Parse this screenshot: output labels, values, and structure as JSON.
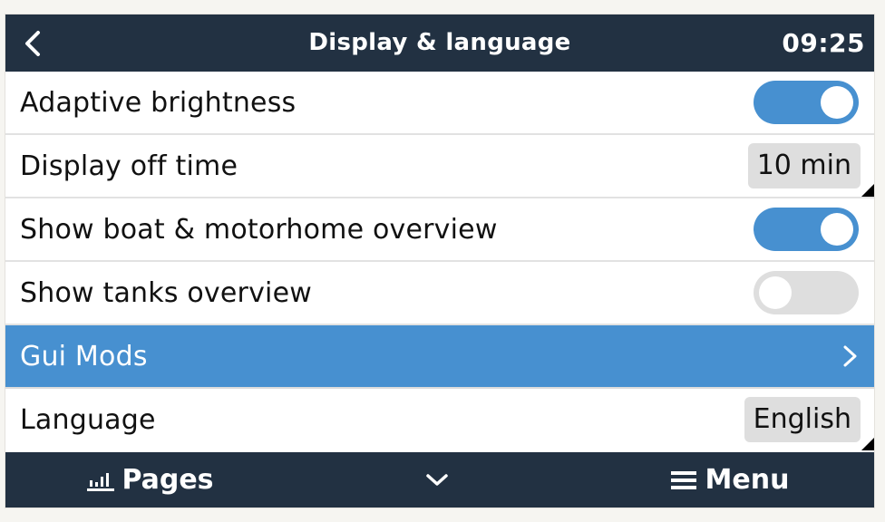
{
  "header": {
    "back_icon": "chevron-left-icon",
    "title": "Display & language",
    "time": "09:25"
  },
  "colors": {
    "header_bg": "#223142",
    "accent": "#4790d0",
    "toggle_off": "#dedede",
    "value_box_bg": "#dedede",
    "page_bg": "#f6f5f1"
  },
  "settings": [
    {
      "label": "Adaptive brightness",
      "type": "toggle",
      "on": true
    },
    {
      "label": "Display off time",
      "type": "value",
      "value": "10 min"
    },
    {
      "label": "Show boat & motorhome overview",
      "type": "toggle",
      "on": true
    },
    {
      "label": "Show tanks overview",
      "type": "toggle",
      "on": false
    },
    {
      "label": "Gui Mods",
      "type": "submenu",
      "selected": true,
      "icon": "chevron-right-icon"
    },
    {
      "label": "Language",
      "type": "value",
      "value": "English"
    }
  ],
  "footer": {
    "pages_label": "Pages",
    "pages_icon": "bar-chart-icon",
    "scroll_icon": "chevron-down-icon",
    "menu_label": "Menu",
    "menu_icon": "hamburger-menu-icon"
  }
}
